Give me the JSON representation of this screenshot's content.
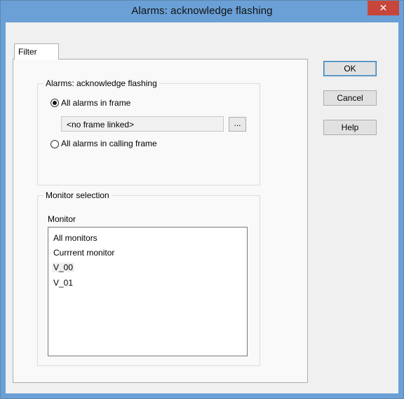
{
  "window": {
    "title": "Alarms: acknowledge flashing",
    "close_symbol": "✕"
  },
  "tabs": [
    {
      "label": "Filter",
      "active": true
    }
  ],
  "ack_group": {
    "legend": "Alarms: acknowledge flashing",
    "option_frame": {
      "label": "All alarms in frame",
      "selected": true
    },
    "frame_field": {
      "value": "<no frame linked>"
    },
    "browse_label": "...",
    "option_calling": {
      "label": "All alarms in calling frame",
      "selected": false
    }
  },
  "monitor_group": {
    "legend": "Monitor selection",
    "list_label": "Monitor",
    "items": [
      "All monitors",
      "Currrent monitor",
      "V_00",
      "V_01"
    ],
    "highlighted_index": 2
  },
  "buttons": {
    "ok": "OK",
    "cancel": "Cancel",
    "help": "Help"
  },
  "colors": {
    "titlebar": "#6aa0d6",
    "close_button": "#c7463c",
    "dialog_background": "#f0f0f0"
  }
}
